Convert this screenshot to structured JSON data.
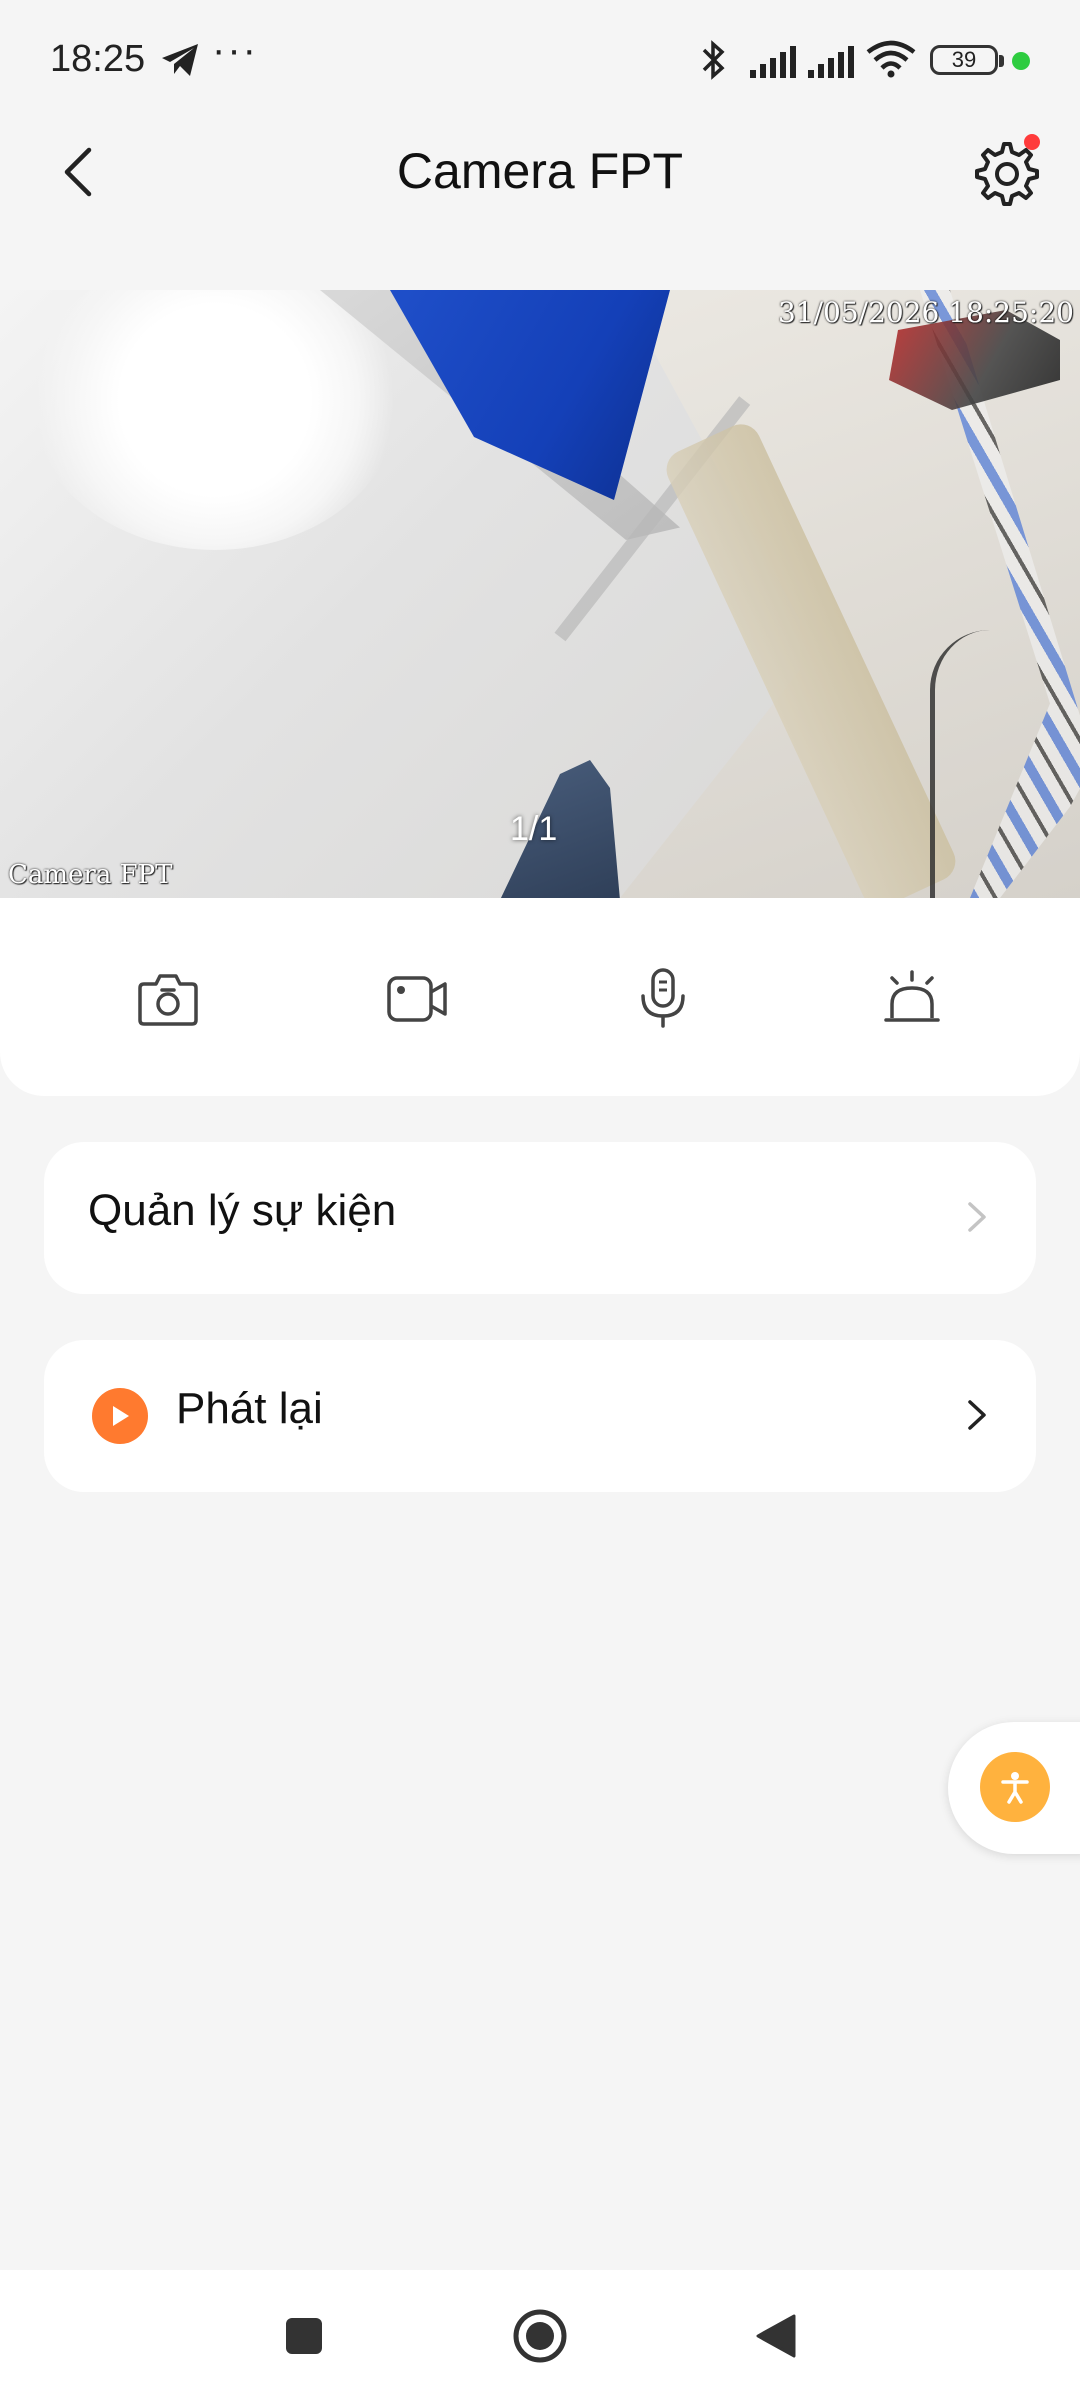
{
  "status_bar": {
    "time": "18:25",
    "more": "···",
    "battery": "39",
    "colors": {
      "dot": "#2ecc40"
    }
  },
  "header": {
    "title": "Camera FPT",
    "icons": {
      "back": "chevron-left-icon",
      "settings": "gear-icon"
    },
    "colors": {
      "notification_dot": "#ff3b3b"
    }
  },
  "video": {
    "timestamp": "31/05/2026  18:25:20",
    "camera_label": "Camera  FPT",
    "page_indicator": "1/1"
  },
  "controls": [
    {
      "name": "snapshot",
      "icon": "camera-icon"
    },
    {
      "name": "record",
      "icon": "video-camera-icon"
    },
    {
      "name": "talk",
      "icon": "microphone-icon"
    },
    {
      "name": "alarm",
      "icon": "siren-icon"
    }
  ],
  "menu": {
    "events": {
      "label": "Quản lý sự kiện",
      "icon": "chevron-right-icon"
    },
    "playback": {
      "label": "Phát lại",
      "icon": "play-circle-icon",
      "colors": {
        "icon": "#ff7a2f"
      }
    }
  },
  "fab": {
    "icon": "accessibility-icon",
    "colors": {
      "bg": "#ffb23e"
    }
  },
  "nav": {
    "icons": [
      "square-icon",
      "home-circle-icon",
      "back-triangle-icon"
    ]
  }
}
